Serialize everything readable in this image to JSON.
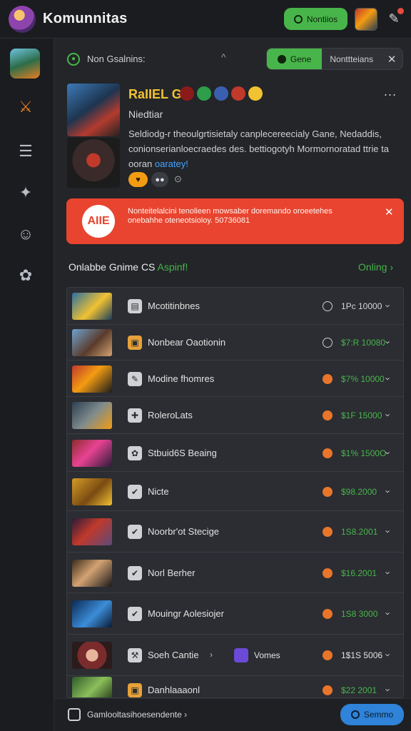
{
  "app": {
    "title": "Komunnitas"
  },
  "topbar": {
    "notif_label": "Nontiios"
  },
  "channel": {
    "name": "Non Gsalnins:",
    "caret": "^",
    "seg_active": "Gene",
    "seg_other": "Nonttteians",
    "close": "✕"
  },
  "post": {
    "title": "RaIIEL G",
    "subtitle": "Niedtiar",
    "body": "Seldiodg-r theoulgrtisietaly canplecereecialy Gane, Nedaddis, conionserianloecraedes des. bettiogotyh Mormornoratad ttrie ta",
    "link_prefix": "ooran",
    "link": "oaratey!",
    "react1": "♥",
    "react2": "●●",
    "react_add": "⊙",
    "more": "..."
  },
  "alert": {
    "badge": "AIIE",
    "text": "Nonteitelalcini tenolieen mowsaber doremando oroeetehes onebahhe oteneotsioloy. 50736081",
    "close": "✕"
  },
  "section": {
    "title": "Onlabbe Gnime CS",
    "accent": "Aspinf!",
    "link": "Onling ›"
  },
  "games": [
    {
      "name": "Mcotitinbnes",
      "stat": "clock",
      "value": "1Pc 10000",
      "value_color": "#d6d6d6"
    },
    {
      "name": "Nonbear Oaotionin",
      "stat": "clock",
      "value": "$7:R 10080",
      "value_color": "#48b54a"
    },
    {
      "name": "Modine fhomres",
      "stat": "fire",
      "value": "$7% 10000",
      "value_color": "#48b54a"
    },
    {
      "name": "RoleroLats",
      "stat": "fire",
      "value": "$1F 15000",
      "value_color": "#48b54a"
    },
    {
      "name": "Stbuid6S Beaing",
      "stat": "fire",
      "value": "$1% 1500O",
      "value_color": "#48b54a"
    },
    {
      "name": "Nicte",
      "stat": "fire",
      "value": "$98.2000",
      "value_color": "#48b54a"
    },
    {
      "name": "Noorbr'ot Stecige",
      "stat": "fire",
      "value": "1S8.2001",
      "value_color": "#48b54a"
    },
    {
      "name": "Norl Berher",
      "stat": "fire",
      "value": "$16.2001",
      "value_color": "#48b54a"
    },
    {
      "name": "Mouingr Aolesiojer",
      "stat": "fire",
      "value": "1S8 3000",
      "value_color": "#48b54a"
    },
    {
      "name": "Soeh Cantie",
      "stat": "fire",
      "value": "1$1S 5006",
      "value_color": "#e2e2e2",
      "extra_arrow": "›",
      "extra_text": "Vomes"
    },
    {
      "name": "Danhlaaaonl",
      "stat": "fire",
      "value": "$22 2001",
      "value_color": "#48b54a"
    }
  ],
  "bottombar": {
    "text": "Gamlooltasihoesendente ›",
    "button": "Semmo"
  }
}
